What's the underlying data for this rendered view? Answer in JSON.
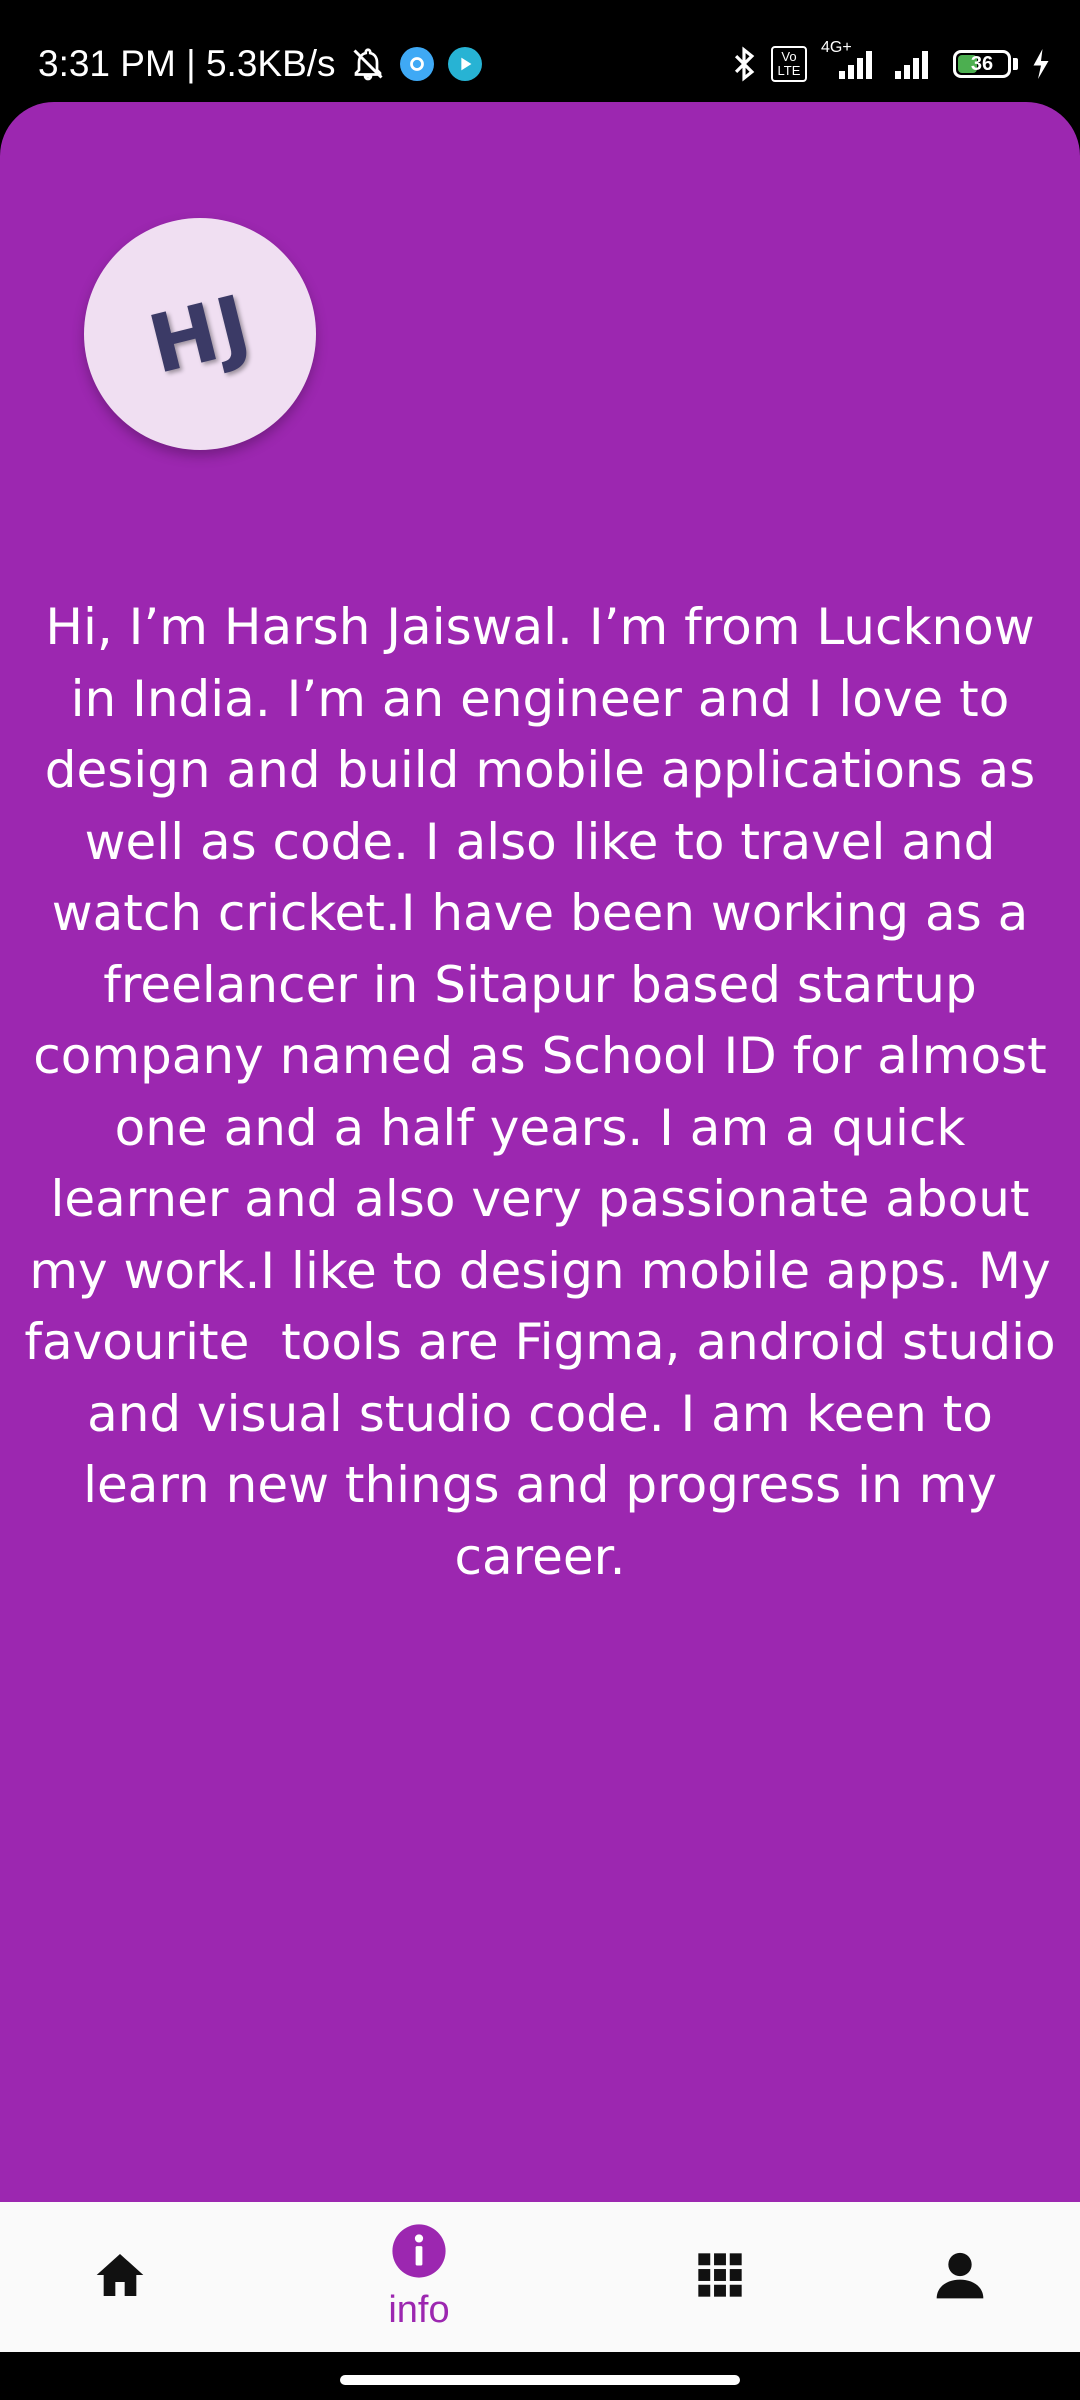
{
  "status_bar": {
    "time_speed": "3:31 PM | 5.3KB/s",
    "network_label": "4G+",
    "volte_label": "Vo LTE",
    "battery_level": "36"
  },
  "profile": {
    "avatar_initials": "HJ",
    "bio": "Hi, I’m Harsh Jaiswal. I’m from Lucknow in India. I’m an engineer and I love to design and build mobile applications as well as code. I also like to travel and watch cricket.I have been working as a freelancer in Sitapur based startup company named as School ID for almost one and a half years. I am a quick learner and also very passionate about my work.I like to design mobile apps. My favourite  tools are Figma, android studio and visual studio code. I am keen to learn new things and progress in my career."
  },
  "bottom_nav": {
    "items": [
      {
        "icon": "home-icon",
        "label": ""
      },
      {
        "icon": "info-icon",
        "label": "info",
        "active": true
      },
      {
        "icon": "apps-grid-icon",
        "label": ""
      },
      {
        "icon": "person-icon",
        "label": ""
      }
    ]
  },
  "colors": {
    "primary": "#9c27b0",
    "nav_background": "#fafafa",
    "avatar_background": "#f0dff2"
  }
}
